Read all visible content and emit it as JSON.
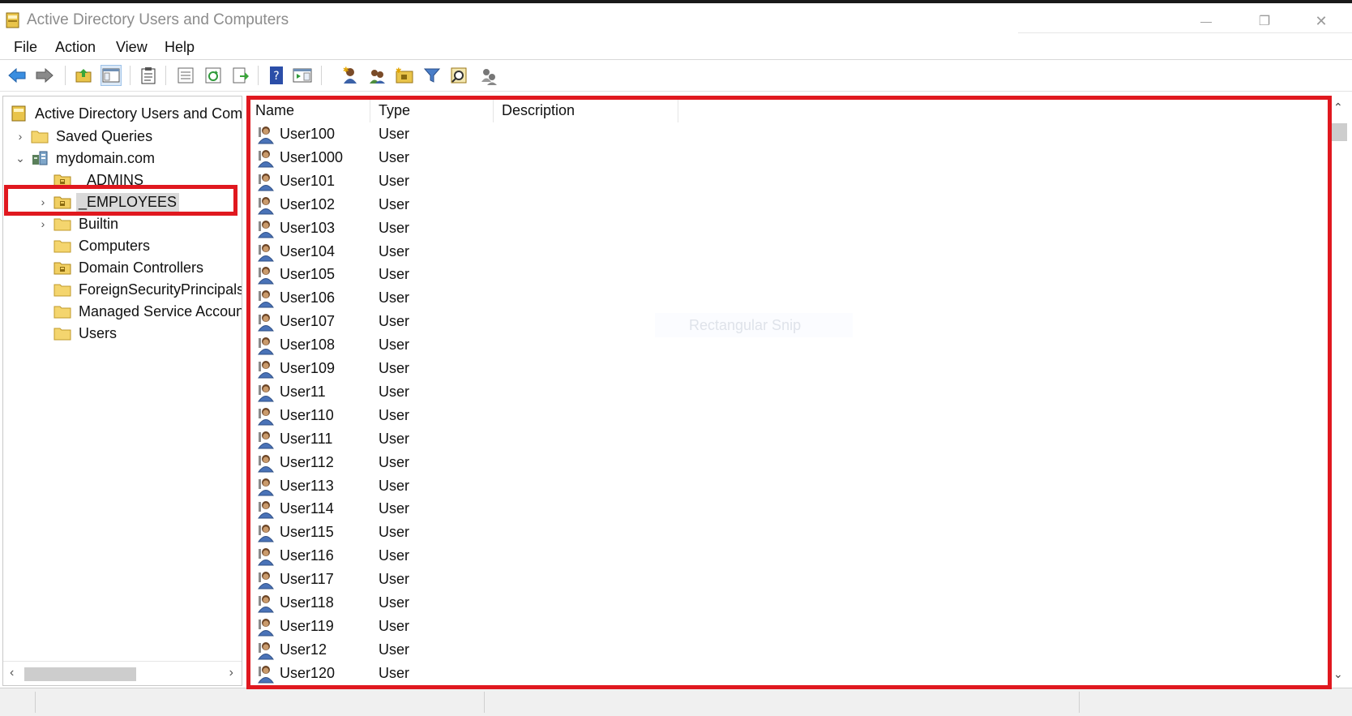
{
  "window": {
    "title": "Active Directory Users and Computers",
    "minimize_glyph": "—",
    "restore_glyph": "❐",
    "close_glyph": "✕"
  },
  "menu": [
    "File",
    "Action",
    "View",
    "Help"
  ],
  "toolbar": {
    "icons": [
      "back-arrow-icon",
      "forward-arrow-icon",
      "up-folder-icon",
      "show-hide-console-tree-icon",
      "clipboard-icon",
      "properties-icon",
      "refresh-icon",
      "export-list-icon",
      "help-icon",
      "show-action-pane-icon",
      "new-user-icon",
      "new-group-icon",
      "new-ou-icon",
      "filter-icon",
      "find-icon",
      "add-to-group-icon"
    ]
  },
  "tree": {
    "root": "Active Directory Users and Comp",
    "items": [
      {
        "label": "Saved Queries",
        "icon": "folder-icon",
        "expander": "›"
      },
      {
        "label": "mydomain.com",
        "icon": "domain-icon",
        "expander": "⌄"
      },
      {
        "label": "_ADMINS",
        "icon": "ou-folder-icon",
        "expander": ""
      },
      {
        "label": "_EMPLOYEES",
        "icon": "ou-folder-icon",
        "expander": "›",
        "selected": true
      },
      {
        "label": "Builtin",
        "icon": "folder-icon",
        "expander": "›"
      },
      {
        "label": "Computers",
        "icon": "folder-icon",
        "expander": ""
      },
      {
        "label": "Domain Controllers",
        "icon": "ou-folder-icon",
        "expander": ""
      },
      {
        "label": "ForeignSecurityPrincipals",
        "icon": "folder-icon",
        "expander": ""
      },
      {
        "label": "Managed Service Accoun",
        "icon": "folder-icon",
        "expander": ""
      },
      {
        "label": "Users",
        "icon": "folder-icon",
        "expander": ""
      }
    ]
  },
  "list": {
    "columns": [
      "Name",
      "Type",
      "Description"
    ],
    "rows": [
      {
        "name": "User100",
        "type": "User"
      },
      {
        "name": "User1000",
        "type": "User"
      },
      {
        "name": "User101",
        "type": "User"
      },
      {
        "name": "User102",
        "type": "User"
      },
      {
        "name": "User103",
        "type": "User"
      },
      {
        "name": "User104",
        "type": "User"
      },
      {
        "name": "User105",
        "type": "User"
      },
      {
        "name": "User106",
        "type": "User"
      },
      {
        "name": "User107",
        "type": "User"
      },
      {
        "name": "User108",
        "type": "User"
      },
      {
        "name": "User109",
        "type": "User"
      },
      {
        "name": "User11",
        "type": "User"
      },
      {
        "name": "User110",
        "type": "User"
      },
      {
        "name": "User111",
        "type": "User"
      },
      {
        "name": "User112",
        "type": "User"
      },
      {
        "name": "User113",
        "type": "User"
      },
      {
        "name": "User114",
        "type": "User"
      },
      {
        "name": "User115",
        "type": "User"
      },
      {
        "name": "User116",
        "type": "User"
      },
      {
        "name": "User117",
        "type": "User"
      },
      {
        "name": "User118",
        "type": "User"
      },
      {
        "name": "User119",
        "type": "User"
      },
      {
        "name": "User12",
        "type": "User"
      },
      {
        "name": "User120",
        "type": "User"
      }
    ]
  },
  "overlay": {
    "ghost_text": "Rectangular Snip",
    "highlight_color": "#e0181f"
  },
  "scroll": {
    "left_arrow": "‹",
    "right_arrow": "›",
    "up_arrow": "⌃",
    "down_arrow": "⌄"
  }
}
